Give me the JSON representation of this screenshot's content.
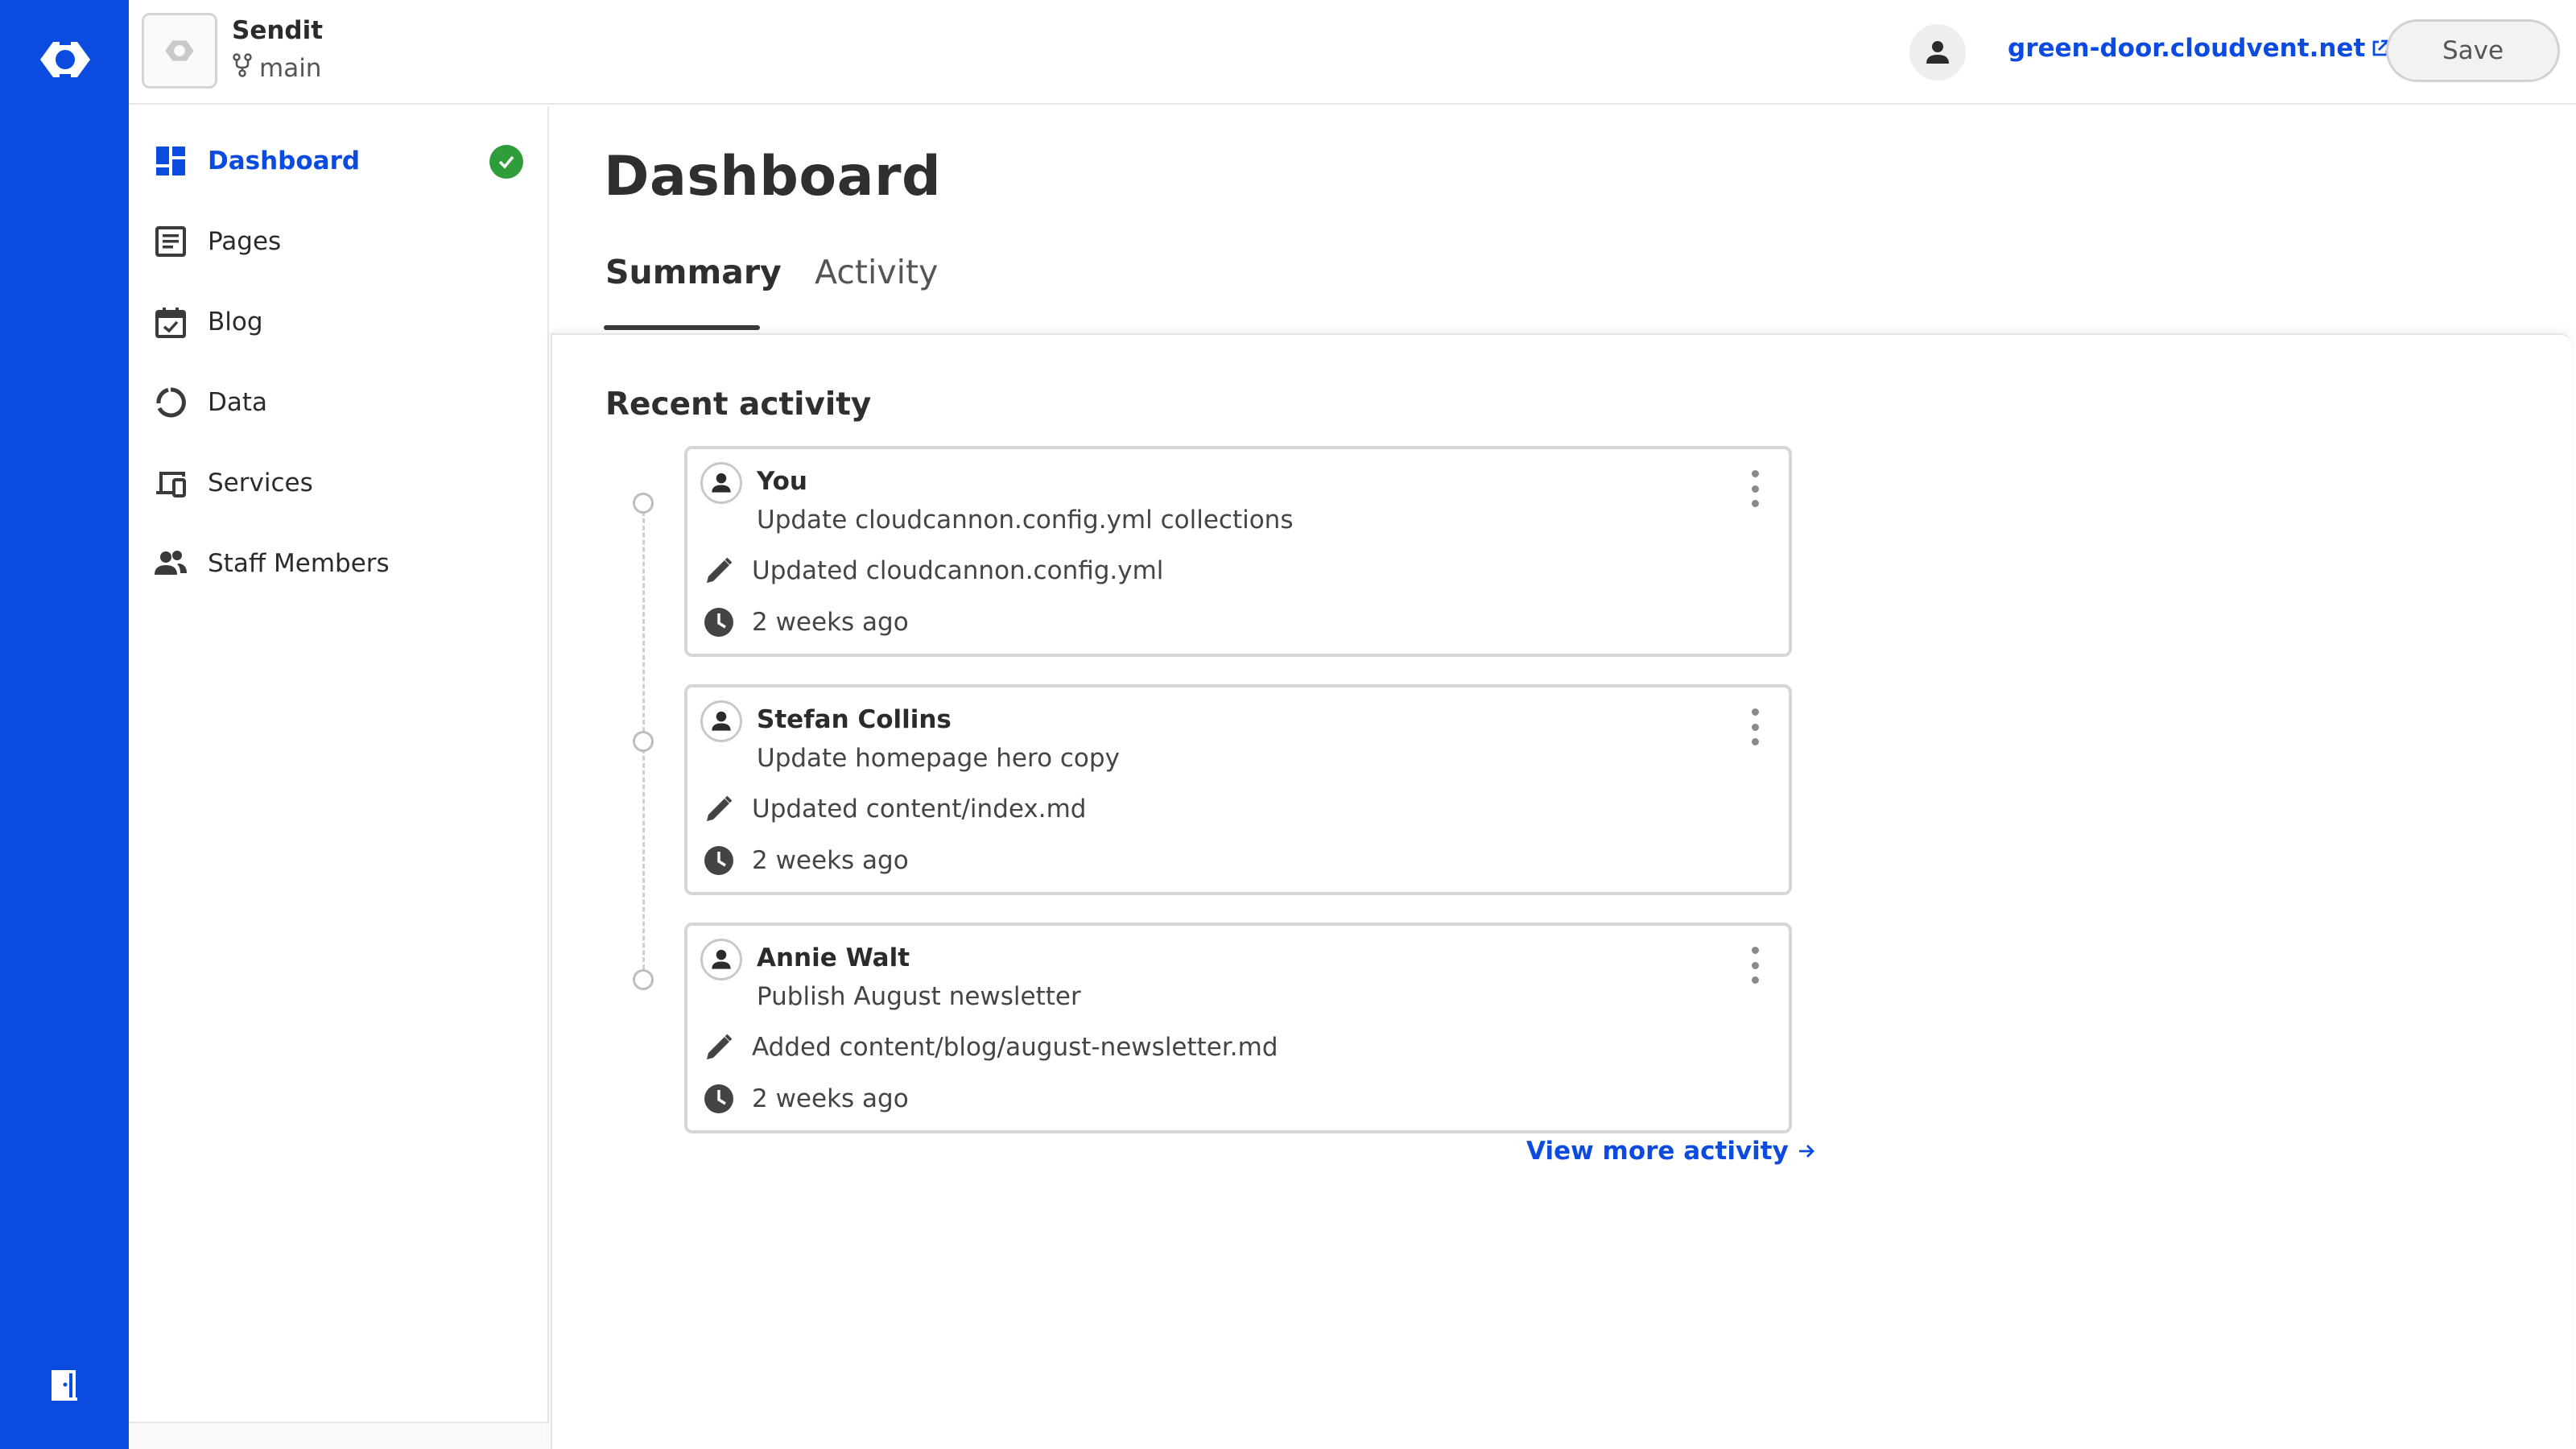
{
  "app": {
    "brand_color": "#0c4be0",
    "rail_icons": [
      "cloudcannon-logo-icon",
      "exit-door-icon"
    ]
  },
  "header": {
    "site_name": "Sendit",
    "branch": "main",
    "site_url": "green-door.cloudvent.net",
    "save_label": "Save"
  },
  "sidebar": {
    "items": [
      {
        "label": "Dashboard",
        "icon": "dashboard-icon",
        "active": true,
        "status": "check-circle-icon"
      },
      {
        "label": "Pages",
        "icon": "pages-icon"
      },
      {
        "label": "Blog",
        "icon": "blog-calendar-icon"
      },
      {
        "label": "Data",
        "icon": "data-donut-icon"
      },
      {
        "label": "Services",
        "icon": "services-devices-icon"
      },
      {
        "label": "Staff Members",
        "icon": "people-icon"
      }
    ]
  },
  "main": {
    "title": "Dashboard",
    "tabs": [
      {
        "label": "Summary",
        "active": true
      },
      {
        "label": "Activity",
        "active": false
      }
    ],
    "section_title": "Recent activity",
    "activities": [
      {
        "author": "You",
        "message": "Update cloudcannon.config.yml collections",
        "change": "Updated cloudcannon.config.yml",
        "time": "2 weeks ago"
      },
      {
        "author": "Stefan Collins",
        "message": "Update homepage hero copy",
        "change": "Updated content/index.md",
        "time": "2 weeks ago"
      },
      {
        "author": "Annie Walt",
        "message": "Publish August newsletter",
        "change": "Added content/blog/august-newsletter.md",
        "time": "2 weeks ago"
      }
    ],
    "view_more": "View more activity"
  }
}
